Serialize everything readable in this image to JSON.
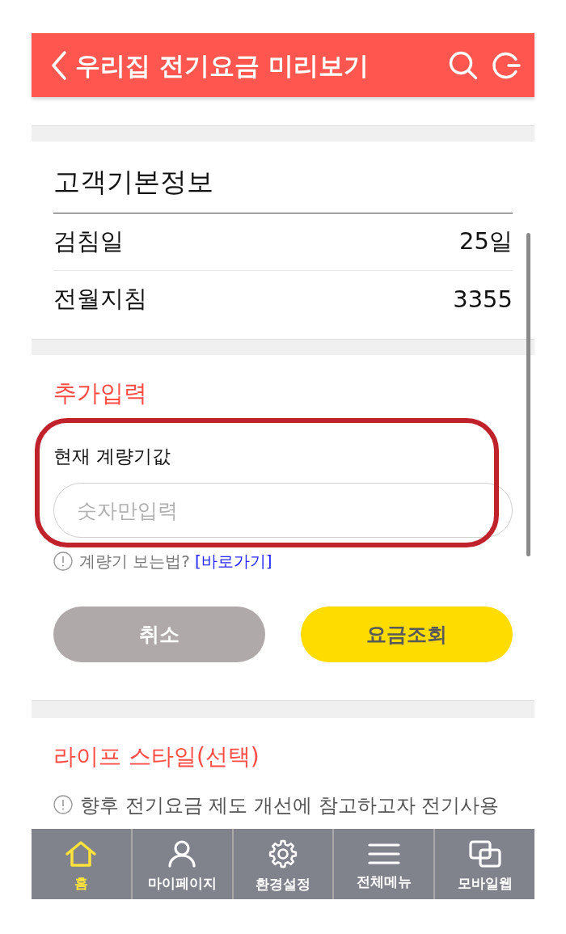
{
  "header": {
    "title": "우리집 전기요금 미리보기"
  },
  "customer_info": {
    "title": "고객기본정보",
    "rows": [
      {
        "label": "검침일",
        "value": "25일"
      },
      {
        "label": "전월지침",
        "value": "3355"
      }
    ]
  },
  "additional_input": {
    "title": "추가입력",
    "field": {
      "label": "현재 계량기값",
      "placeholder": "숫자만입력"
    },
    "help": {
      "text": "계량기 보는법?",
      "link": "[바로가기]"
    },
    "buttons": [
      {
        "label": "취소",
        "kind": "cancel"
      },
      {
        "label": "요금조회",
        "kind": "primary"
      }
    ]
  },
  "lifestyle": {
    "title": "라이프 스타일(선택)",
    "notice": "향후 전기요금 제도 개선에 참고하고자 전기사용"
  },
  "bottom_nav": [
    {
      "label": "홈",
      "selected": true
    },
    {
      "label": "마이페이지",
      "selected": false
    },
    {
      "label": "환경설정",
      "selected": false
    },
    {
      "label": "전체메뉴",
      "selected": false
    },
    {
      "label": "모바일웹",
      "selected": false
    }
  ]
}
